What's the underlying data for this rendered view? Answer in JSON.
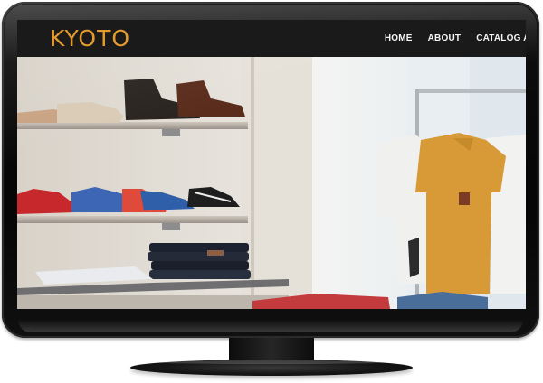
{
  "site": {
    "logo": "KYOTO",
    "nav": [
      "HOME",
      "ABOUT",
      "CATALOG AN"
    ]
  },
  "colors": {
    "brand_orange": "#e59a2e",
    "navbar_bg": "#1a1a1a",
    "nav_text": "#f4f4f4",
    "bezel": "#0a0a0a"
  },
  "hero": {
    "description": "",
    "icons": []
  }
}
